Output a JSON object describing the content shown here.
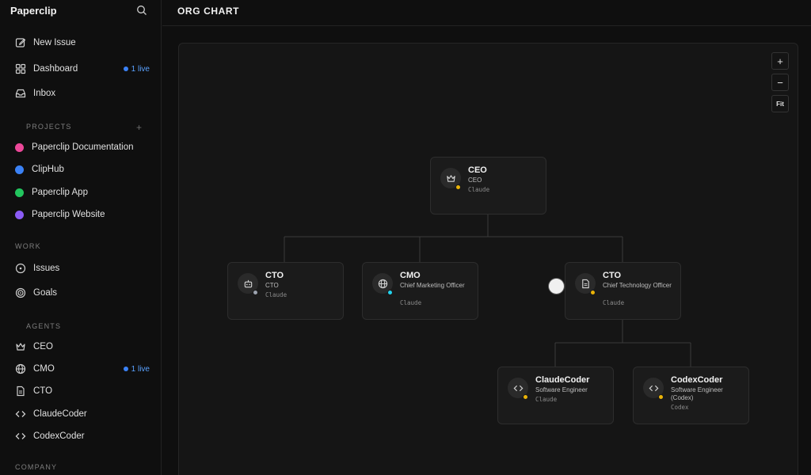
{
  "app": {
    "title": "Paperclip"
  },
  "nav": {
    "new_issue": "New Issue",
    "dashboard": "Dashboard",
    "dashboard_badge": "1 live",
    "inbox": "Inbox"
  },
  "projects": {
    "heading": "PROJECTS",
    "items": [
      {
        "label": "Paperclip Documentation",
        "color": "#ec4899"
      },
      {
        "label": "ClipHub",
        "color": "#3b82f6"
      },
      {
        "label": "Paperclip App",
        "color": "#22c55e"
      },
      {
        "label": "Paperclip Website",
        "color": "#8b5cf6"
      }
    ]
  },
  "work": {
    "heading": "WORK",
    "issues": "Issues",
    "goals": "Goals"
  },
  "agents": {
    "heading": "AGENTS",
    "items": [
      {
        "label": "CEO",
        "icon": "crown-icon"
      },
      {
        "label": "CMO",
        "icon": "globe-icon",
        "badge": "1 live"
      },
      {
        "label": "CTO",
        "icon": "document-icon"
      },
      {
        "label": "ClaudeCoder",
        "icon": "code-icon"
      },
      {
        "label": "CodexCoder",
        "icon": "code-icon"
      }
    ]
  },
  "company": {
    "heading": "COMPANY"
  },
  "header": {
    "title": "ORG CHART"
  },
  "zoom": {
    "in": "+",
    "out": "−",
    "fit": "Fit"
  },
  "org": {
    "ceo": {
      "name": "CEO",
      "role": "CEO",
      "adapter": "Claude",
      "status_color": "#eab308",
      "icon": "crown-icon"
    },
    "cto1": {
      "name": "CTO",
      "role": "CTO",
      "adapter": "Claude",
      "status_color": "#9ca3af",
      "icon": "robot-icon"
    },
    "cmo": {
      "name": "CMO",
      "role": "Chief Marketing Officer",
      "adapter": "Claude",
      "status_color": "#22d3ee",
      "icon": "globe-icon"
    },
    "cto2": {
      "name": "CTO",
      "role": "Chief Technology Officer",
      "adapter": "Claude",
      "status_color": "#eab308",
      "icon": "document-icon"
    },
    "claudecoder": {
      "name": "ClaudeCoder",
      "role": "Software Engineer",
      "adapter": "Claude",
      "status_color": "#eab308",
      "icon": "code-icon"
    },
    "codexcoder": {
      "name": "CodexCoder",
      "role": "Software Engineer (Codex)",
      "adapter": "Codex",
      "status_color": "#eab308",
      "icon": "code-icon"
    }
  },
  "colors": {
    "accent": "#3b82f6",
    "background": "#0f0f0f",
    "card": "#1b1b1b"
  }
}
